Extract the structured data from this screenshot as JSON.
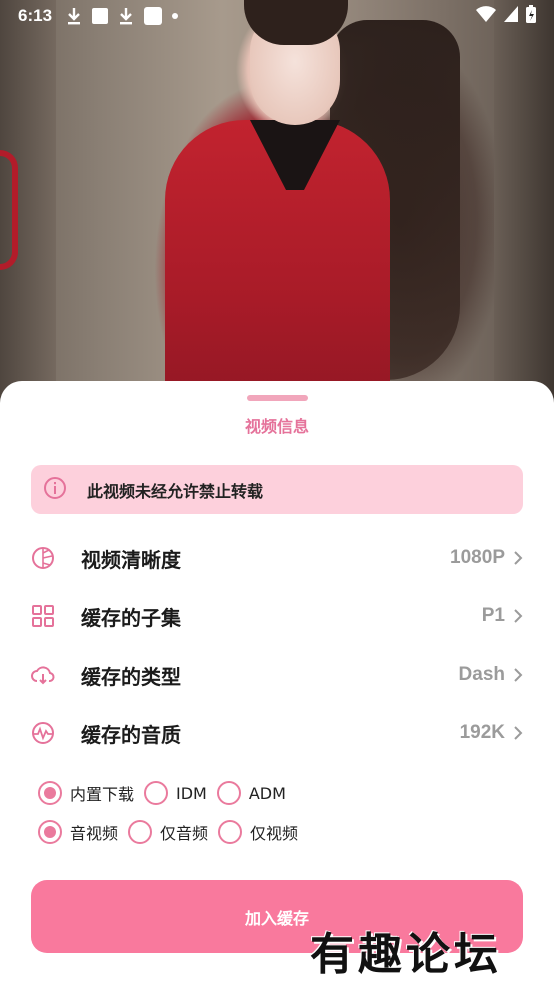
{
  "status_bar": {
    "time": "6:13"
  },
  "sheet": {
    "title": "视频信息",
    "notice": "此视频未经允许禁止转载",
    "rows": [
      {
        "label": "视频清晰度",
        "value": "1080P",
        "icon": "resolution-icon"
      },
      {
        "label": "缓存的子集",
        "value": "P1",
        "icon": "grid-icon"
      },
      {
        "label": "缓存的类型",
        "value": "Dash",
        "icon": "cloud-download-icon"
      },
      {
        "label": "缓存的音质",
        "value": "192K",
        "icon": "audio-wave-icon"
      }
    ],
    "download_options": [
      {
        "label": "内置下载",
        "checked": true
      },
      {
        "label": "IDM",
        "checked": false
      },
      {
        "label": "ADM",
        "checked": false
      }
    ],
    "content_options": [
      {
        "label": "音视频",
        "checked": true
      },
      {
        "label": "仅音频",
        "checked": false
      },
      {
        "label": "仅视频",
        "checked": false
      }
    ],
    "add_button": "加入缓存"
  },
  "watermark": "有趣论坛",
  "colors": {
    "accent": "#f9799d",
    "accent_light": "#fdd0dc",
    "title_pink": "#e5729a",
    "value_gray": "#9b9b9b"
  }
}
